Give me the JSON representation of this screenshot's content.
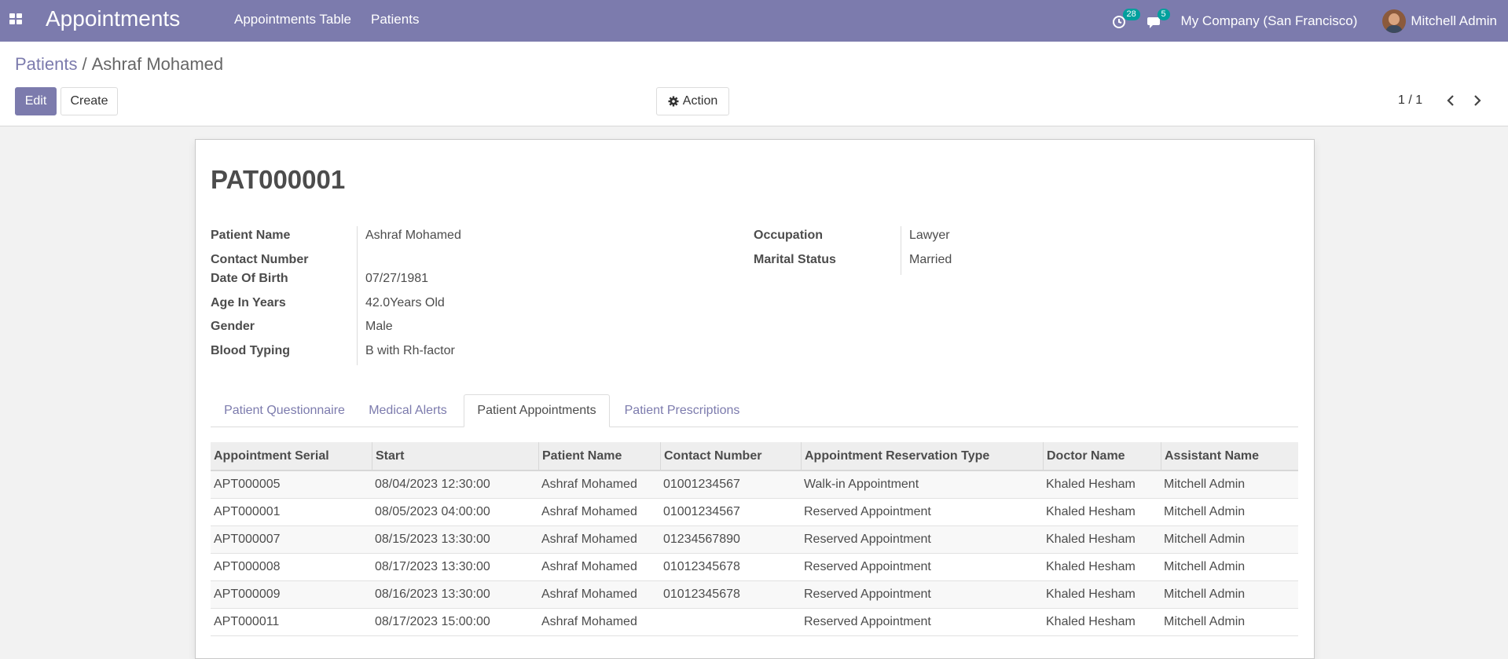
{
  "navbar": {
    "app_title": "Appointments",
    "menu": [
      "Appointments Table",
      "Patients"
    ],
    "activity_count": "28",
    "message_count": "5",
    "company": "My Company (San Francisco)",
    "user": "Mitchell Admin"
  },
  "breadcrumb": {
    "parent": "Patients",
    "separator": "/",
    "current": "Ashraf Mohamed"
  },
  "buttons": {
    "edit": "Edit",
    "create": "Create",
    "action": "Action"
  },
  "pager": "1 / 1",
  "record": {
    "title": "PAT000001",
    "left_fields": [
      {
        "label": "Patient Name",
        "value": "Ashraf Mohamed"
      },
      {
        "label": "Contact Number",
        "value": ""
      },
      {
        "label": "Date Of Birth",
        "value": "07/27/1981"
      },
      {
        "label": "Age In Years",
        "value": "42.0Years Old"
      },
      {
        "label": "Gender",
        "value": "Male"
      },
      {
        "label": "Blood Typing",
        "value": "B with Rh-factor"
      }
    ],
    "right_fields": [
      {
        "label": "Occupation",
        "value": "Lawyer"
      },
      {
        "label": "Marital Status",
        "value": "Married"
      }
    ]
  },
  "tabs": [
    "Patient Questionnaire",
    "Medical Alerts",
    "Patient Appointments",
    "Patient Prescriptions"
  ],
  "active_tab": "Patient Appointments",
  "table": {
    "columns": [
      "Appointment Serial",
      "Start",
      "Patient Name",
      "Contact Number",
      "Appointment Reservation Type",
      "Doctor Name",
      "Assistant Name"
    ],
    "rows": [
      [
        "APT000005",
        "08/04/2023 12:30:00",
        "Ashraf Mohamed",
        "01001234567",
        "Walk-in Appointment",
        "Khaled Hesham",
        "Mitchell Admin"
      ],
      [
        "APT000001",
        "08/05/2023 04:00:00",
        "Ashraf Mohamed",
        "01001234567",
        "Reserved Appointment",
        "Khaled Hesham",
        "Mitchell Admin"
      ],
      [
        "APT000007",
        "08/15/2023 13:30:00",
        "Ashraf Mohamed",
        "01234567890",
        "Reserved Appointment",
        "Khaled Hesham",
        "Mitchell Admin"
      ],
      [
        "APT000008",
        "08/17/2023 13:30:00",
        "Ashraf Mohamed",
        "01012345678",
        "Reserved Appointment",
        "Khaled Hesham",
        "Mitchell Admin"
      ],
      [
        "APT000009",
        "08/16/2023 13:30:00",
        "Ashraf Mohamed",
        "01012345678",
        "Reserved Appointment",
        "Khaled Hesham",
        "Mitchell Admin"
      ],
      [
        "APT000011",
        "08/17/2023 15:00:00",
        "Ashraf Mohamed",
        "",
        "Reserved Appointment",
        "Khaled Hesham",
        "Mitchell Admin"
      ]
    ]
  },
  "colors": {
    "brand": "#7c7bad",
    "badge": "#00a09d"
  }
}
